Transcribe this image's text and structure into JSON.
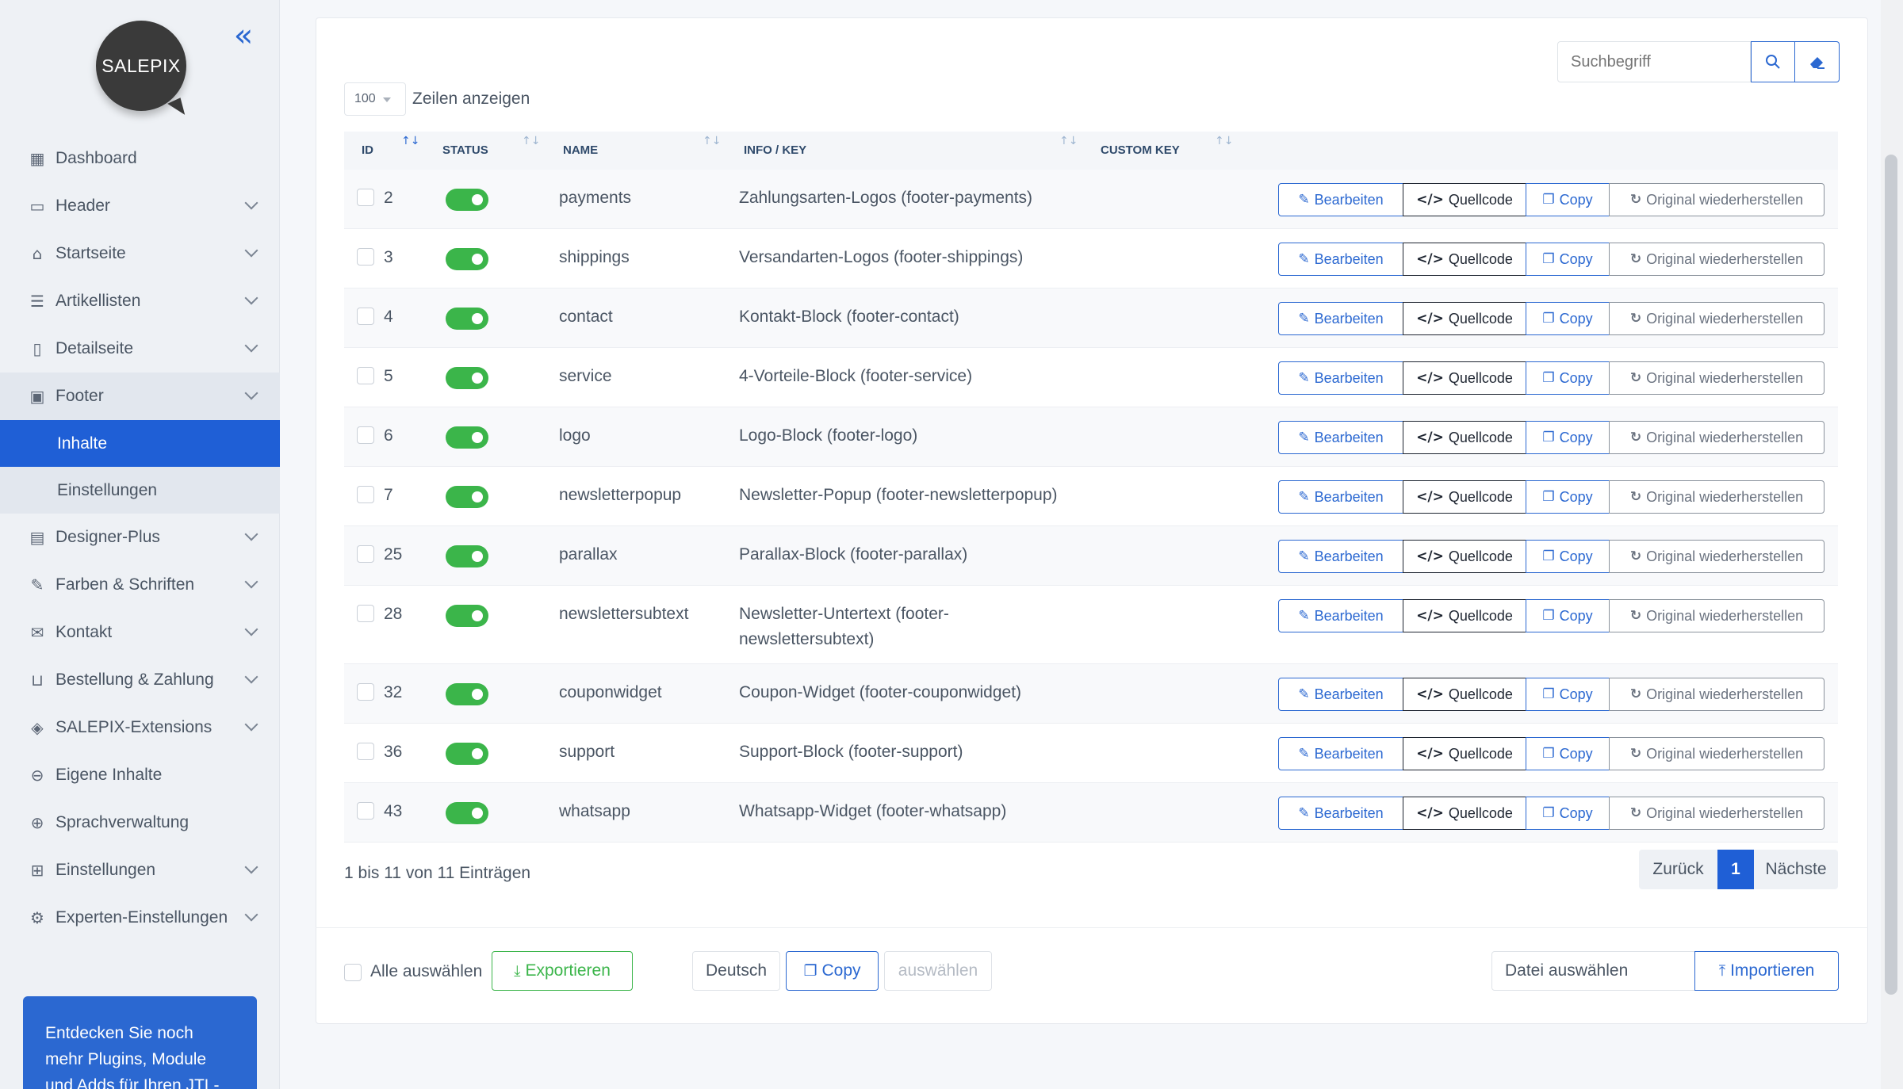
{
  "sidebar": {
    "logo": "SALEPIX",
    "collapse_icon": "double-chevron-left-icon",
    "items": [
      {
        "label": "Dashboard",
        "icon": "dashboard-icon",
        "chevron": false
      },
      {
        "label": "Header",
        "icon": "header-icon",
        "chevron": true
      },
      {
        "label": "Startseite",
        "icon": "home-icon",
        "chevron": true
      },
      {
        "label": "Artikellisten",
        "icon": "list-icon",
        "chevron": true
      },
      {
        "label": "Detailseite",
        "icon": "page-icon",
        "chevron": true
      },
      {
        "label": "Footer",
        "icon": "footer-icon",
        "chevron": true,
        "open": true
      },
      {
        "label": "Designer-Plus",
        "icon": "layout-icon",
        "chevron": true
      },
      {
        "label": "Farben & Schriften",
        "icon": "paint-icon",
        "chevron": true
      },
      {
        "label": "Kontakt",
        "icon": "mail-icon",
        "chevron": true
      },
      {
        "label": "Bestellung & Zahlung",
        "icon": "basket-icon",
        "chevron": true
      },
      {
        "label": "SALEPIX-Extensions",
        "icon": "cube-icon",
        "chevron": true
      },
      {
        "label": "Eigene Inhalte",
        "icon": "toggle-icon",
        "chevron": false
      },
      {
        "label": "Sprachverwaltung",
        "icon": "globe-icon",
        "chevron": false
      },
      {
        "label": "Einstellungen",
        "icon": "grid-icon",
        "chevron": true
      },
      {
        "label": "Experten-Einstellungen",
        "icon": "gear-icon",
        "chevron": true
      }
    ],
    "footer_sub": [
      {
        "label": "Inhalte",
        "active": true
      },
      {
        "label": "Einstellungen",
        "active": false
      }
    ],
    "promo": "Entdecken Sie noch mehr Plugins, Module und Adds für Ihren JTL-Shop"
  },
  "toolbar": {
    "search_placeholder": "Suchbegriff",
    "rows_value": "100",
    "rows_label": "Zeilen anzeigen"
  },
  "table": {
    "headers": {
      "id": "ID",
      "status": "STATUS",
      "name": "NAME",
      "info": "INFO / KEY",
      "custom": "CUSTOM KEY"
    },
    "actions": {
      "edit": "Bearbeiten",
      "source": "Quellcode",
      "copy": "Copy",
      "restore": "Original wiederherstellen"
    },
    "rows": [
      {
        "id": "2",
        "name": "payments",
        "info": "Zahlungsarten-Logos (footer-payments)",
        "info2": ""
      },
      {
        "id": "3",
        "name": "shippings",
        "info": "Versandarten-Logos (footer-shippings)",
        "info2": ""
      },
      {
        "id": "4",
        "name": "contact",
        "info": "Kontakt-Block (footer-contact)",
        "info2": ""
      },
      {
        "id": "5",
        "name": "service",
        "info": "4-Vorteile-Block (footer-service)",
        "info2": ""
      },
      {
        "id": "6",
        "name": "logo",
        "info": "Logo-Block (footer-logo)",
        "info2": ""
      },
      {
        "id": "7",
        "name": "newsletterpopup",
        "info": "Newsletter-Popup (footer-newsletterpopup)",
        "info2": ""
      },
      {
        "id": "25",
        "name": "parallax",
        "info": "Parallax-Block (footer-parallax)",
        "info2": ""
      },
      {
        "id": "28",
        "name": "newslettersubtext",
        "info": "Newsletter-Untertext (footer-",
        "info2": "newslettersubtext)"
      },
      {
        "id": "32",
        "name": "couponwidget",
        "info": "Coupon-Widget (footer-couponwidget)",
        "info2": ""
      },
      {
        "id": "36",
        "name": "support",
        "info": "Support-Block (footer-support)",
        "info2": ""
      },
      {
        "id": "43",
        "name": "whatsapp",
        "info": "Whatsapp-Widget (footer-whatsapp)",
        "info2": ""
      }
    ]
  },
  "pagination": {
    "info": "1 bis 11 von 11 Einträgen",
    "prev": "Zurück",
    "current": "1",
    "next": "Nächste"
  },
  "footer": {
    "select_all": "Alle auswählen",
    "export": "Exportieren",
    "language": "Deutsch",
    "copy": "Copy",
    "choose": "auswählen",
    "file": "Datei auswählen",
    "import": "Importieren"
  },
  "colors": {
    "primary": "#1f5fd6",
    "success": "#3bb54a",
    "sidebar_bg": "#eef1f5"
  }
}
